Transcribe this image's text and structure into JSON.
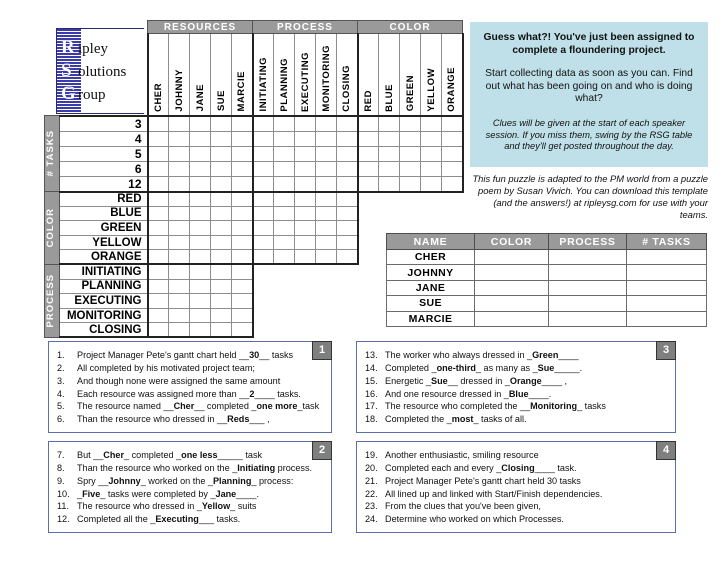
{
  "logo": {
    "line1_cap": "R",
    "line1_rest": "ipley",
    "line2_cap": "S",
    "line2_rest": "olutions",
    "line3_cap": "G",
    "line3_rest": "roup"
  },
  "grid": {
    "groups": [
      {
        "label": "Resources",
        "cols": [
          "Cher",
          "Johnny",
          "Jane",
          "Sue",
          "Marcie"
        ]
      },
      {
        "label": "Process",
        "cols": [
          "Initiating",
          "Planning",
          "Executing",
          "Monitoring",
          "Closing"
        ]
      },
      {
        "label": "Color",
        "cols": [
          "Red",
          "Blue",
          "Green",
          "Yellow",
          "Orange"
        ]
      }
    ],
    "row_groups": [
      {
        "label": "# Tasks",
        "rows": [
          "3",
          "4",
          "5",
          "6",
          "12"
        ],
        "numeric": true
      },
      {
        "label": "Color",
        "rows": [
          "Red",
          "Blue",
          "Green",
          "Yellow",
          "Orange"
        ],
        "numeric": false
      },
      {
        "label": "Process",
        "rows": [
          "Initiating",
          "Planning",
          "Executing",
          "Monitoring",
          "Closing"
        ],
        "numeric": false
      }
    ]
  },
  "info": {
    "t1": "Guess what?! You've just been assigned to complete a floundering project.",
    "t2": "Start collecting data as soon as you can.  Find out what has been going on and who is doing what?",
    "t3": "Clues will be given at the start of each speaker session.  If you miss them, swing by the RSG table and they'll get posted throughout the day."
  },
  "credit": "This fun puzzle is adapted to the PM world from a puzzle poem by Susan Vivich.  You can download this template (and the answers!) at ripleysg.com for use with your teams.",
  "answers": {
    "headers": [
      "Name",
      "Color",
      "Process",
      "# Tasks"
    ],
    "rows": [
      "Cher",
      "Johnny",
      "Jane",
      "Sue",
      "Marcie"
    ]
  },
  "clues": [
    {
      "badge": "1",
      "items": [
        {
          "n": "1.",
          "pre": "Project Manager Pete's gantt chart held __",
          "b": "30",
          "post": "__ tasks"
        },
        {
          "n": "2.",
          "pre": "All completed by his motivated project team;",
          "b": "",
          "post": ""
        },
        {
          "n": "3.",
          "pre": "And though none were assigned the same amount",
          "b": "",
          "post": ""
        },
        {
          "n": "4.",
          "pre": "Each resource was assigned more than __",
          "b": "2",
          "post": "____ tasks."
        },
        {
          "n": "5.",
          "pre": "The resource named __",
          "b": "Cher",
          "post": "__ completed _one more_task",
          "b2": "one more"
        },
        {
          "n": "6.",
          "pre": "Than the resource who dressed in __",
          "b": "Reds",
          "post": "___ ,"
        }
      ]
    },
    {
      "badge": "2",
      "items": [
        {
          "n": "7.",
          "pre": "But __",
          "b": "Cher",
          "post": "_ completed _one less_____ task",
          "b2": "one less"
        },
        {
          "n": "8.",
          "pre": "Than the resource who worked on the _",
          "b": "Initiating",
          "post": " process."
        },
        {
          "n": "9.",
          "pre": "Spry __",
          "b": "Johnny",
          "post": "_ worked on the _Planning_ process:",
          "b2": "Planning"
        },
        {
          "n": "10.",
          "pre": "_",
          "b": "Five",
          "post": "_ tasks were completed by _Jane____.",
          "b2": "Jane"
        },
        {
          "n": "11.",
          "pre": "The resource who dressed in _",
          "b": "Yellow",
          "post": "_ suits"
        },
        {
          "n": "12.",
          "pre": "Completed all the _",
          "b": "Executing",
          "post": "___ tasks."
        }
      ]
    },
    {
      "badge": "3",
      "items": [
        {
          "n": "13.",
          "pre": "The worker who always dressed in _",
          "b": "Green",
          "post": "____"
        },
        {
          "n": "14.",
          "pre": "Completed _",
          "b": "one-third",
          "post": "_ as many as _Sue_____.",
          "b2": "Sue"
        },
        {
          "n": "15.",
          "pre": "Energetic _",
          "b": "Sue",
          "post": "__ dressed in _Orange____ ,",
          "b2": "Orange"
        },
        {
          "n": "16.",
          "pre": "And one resource dressed in _",
          "b": "Blue",
          "post": "____."
        },
        {
          "n": "17.",
          "pre": "The resource who completed the __",
          "b": "Monitoring",
          "post": "_ tasks"
        },
        {
          "n": "18.",
          "pre": "Completed the _",
          "b": "most",
          "post": "_ tasks of all."
        }
      ]
    },
    {
      "badge": "4",
      "items": [
        {
          "n": "19.",
          "pre": "Another enthusiastic, smiling resource",
          "b": "",
          "post": ""
        },
        {
          "n": "20.",
          "pre": "Completed each and every _",
          "b": "Closing",
          "post": "____ task."
        },
        {
          "n": "21.",
          "pre": "Project Manager Pete's gantt chart held 30 tasks",
          "b": "",
          "post": ""
        },
        {
          "n": "22.",
          "pre": "All lined up and linked with Start/Finish dependencies.",
          "b": "",
          "post": ""
        },
        {
          "n": "23.",
          "pre": "From the clues that you've been given,",
          "b": "",
          "post": ""
        },
        {
          "n": "24.",
          "pre": "Determine who worked on which Processes.",
          "b": "",
          "post": ""
        }
      ]
    }
  ],
  "colors": {
    "group_header": "#9a9a9a",
    "info_bg": "#bfe0e8",
    "logo_band": "#3b3bab",
    "clue_border": "#5b6ea8",
    "badge": "#7f7f7f"
  }
}
